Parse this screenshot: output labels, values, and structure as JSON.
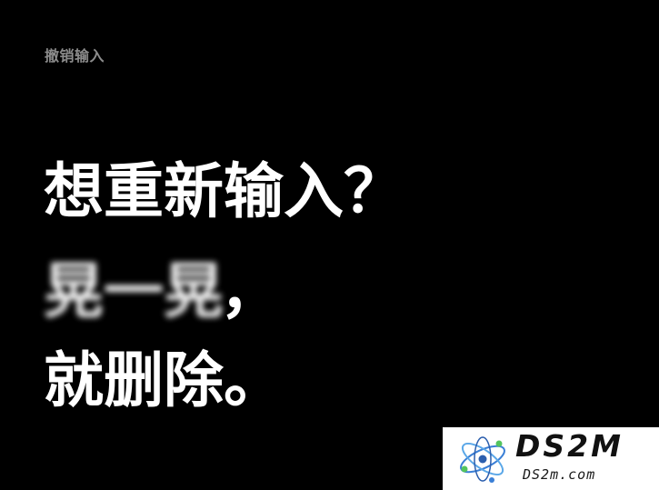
{
  "caption": "撤销输入",
  "headline": {
    "line1": "想重新输入？",
    "line2_blurred": "晃一晃",
    "line2_punct": "，",
    "line3": "就删除。"
  },
  "watermark": {
    "title": "DS2M",
    "url": "DS2m.com",
    "logo_icon": "atom-logo-icon"
  },
  "colors": {
    "background": "#000000",
    "text": "#ffffff",
    "caption": "#8c8c8c"
  }
}
